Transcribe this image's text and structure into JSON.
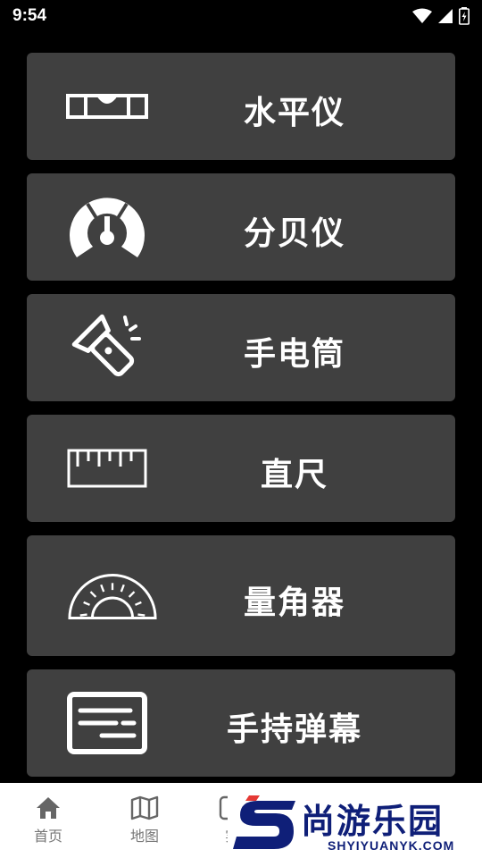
{
  "status_bar": {
    "time": "9:54"
  },
  "tools": [
    {
      "label": "水平仪",
      "icon": "level-icon"
    },
    {
      "label": "分贝仪",
      "icon": "gauge-icon"
    },
    {
      "label": "手电筒",
      "icon": "flashlight-icon"
    },
    {
      "label": "直尺",
      "icon": "ruler-icon"
    },
    {
      "label": "量角器",
      "icon": "protractor-icon"
    },
    {
      "label": "手持弹幕",
      "icon": "subtitles-icon"
    }
  ],
  "bottom_nav": [
    {
      "label": "首页",
      "icon": "home-icon"
    },
    {
      "label": "地图",
      "icon": "map-icon"
    },
    {
      "label": "实",
      "icon": "tools-icon"
    }
  ],
  "watermark": {
    "text": "尚游乐园",
    "url": "SHYIYUANYK.COM"
  },
  "colors": {
    "card": "#404040",
    "background": "#000000",
    "nav": "#ffffff",
    "watermark": "#0f1f78",
    "watermark_accent": "#e53935"
  }
}
